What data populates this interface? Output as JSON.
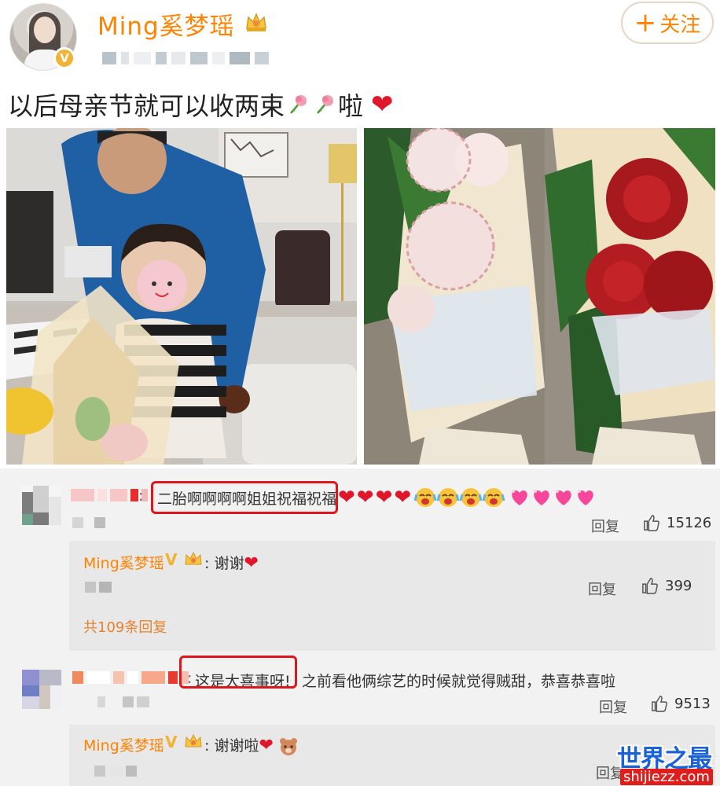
{
  "post": {
    "author": "Ming奚梦瑶",
    "verified_badge": "V",
    "follow_label": "关注",
    "follow_plus": "+",
    "text": "以后母亲节就可以收两束",
    "text_suffix": "啦",
    "heart_glyph": "❤"
  },
  "icons": {
    "author_crown": "crown-icon",
    "flower": "carnation-icon",
    "like": "thumb-up-icon"
  },
  "comments": [
    {
      "text": "二胎啊啊啊啊姐姐祝福祝福",
      "emoji_hearts": "❤❤❤❤",
      "reply_label": "回复",
      "likes": "15126",
      "reply": {
        "author": "Ming奚梦瑶",
        "v": "V",
        "text": "谢谢",
        "heart": "❤",
        "reply_label": "回复",
        "likes": "399"
      },
      "more_replies": "共109条回复"
    },
    {
      "text": "这是大喜事呀!",
      "text_rest": "之前看他俩综艺的时候就觉得贼甜，恭喜恭喜啦",
      "reply_label": "回复",
      "likes": "9513",
      "reply": {
        "author": "Ming奚梦瑶",
        "v": "V",
        "text": "谢谢啦",
        "heart": "❤",
        "reply_label": "回复"
      }
    }
  ],
  "watermark": {
    "title": "世界之最",
    "url": "shijiezz.com"
  },
  "colors": {
    "brand_orange": "#ff8200",
    "highlight_red": "#e0161d",
    "heart_red": "#e0162b",
    "watermark_blue": "#1a63d6"
  }
}
